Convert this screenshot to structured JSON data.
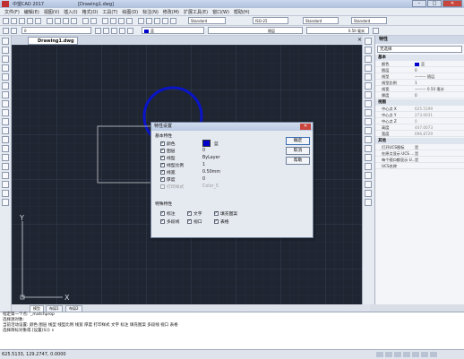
{
  "titlebar": {
    "app_title": "中望CAD 2017",
    "doc_title": "[Drawing1.dwg]",
    "min": "–",
    "max": "□",
    "close": "✕"
  },
  "menu": [
    "文件(F)",
    "编辑(E)",
    "视图(V)",
    "插入(I)",
    "格式(O)",
    "工具(T)",
    "绘图(D)",
    "标注(N)",
    "修改(M)",
    "扩展工具(E)",
    "窗口(W)",
    "帮助(H)"
  ],
  "toolbar": {
    "text_style": "Standard",
    "dim_style": "ISO-25",
    "table_style": "Standard",
    "mleader_style": "Standard",
    "layer": "0",
    "color": "蓝",
    "linetype": "随层",
    "lineweight": "0.50 毫米"
  },
  "tabs": {
    "document": "Drawing1.dwg",
    "close": "×"
  },
  "layout_tabs": [
    "模型",
    "布局1",
    "布局2"
  ],
  "command_lines": [
    "指定第一个点: '_matchprop",
    "选择源对象:",
    "当前活动设置: 颜色 图层 线型 线型比例 线宽 厚度 打印样式 文字 标注 填充图案 多段线 视口 表格",
    "选择目标对象或 [设置(S)]: s"
  ],
  "status": {
    "coords": "625.5133, 129.2747, 0.0000"
  },
  "properties_panel": {
    "title": "特性",
    "selection": "无选择",
    "section_basic": "基本",
    "section_view": "视图",
    "section_misc": "其他",
    "basic_rows": [
      {
        "k": "颜色",
        "v": "蓝",
        "swatch": true
      },
      {
        "k": "图层",
        "v": "0"
      },
      {
        "k": "线型",
        "v": "——— 随层"
      },
      {
        "k": "线型比例",
        "v": "1"
      },
      {
        "k": "线宽",
        "v": "——— 0.50 毫米"
      },
      {
        "k": "厚度",
        "v": "0"
      }
    ],
    "view_rows": [
      {
        "k": "中心点 X",
        "v": "625.5199"
      },
      {
        "k": "中心点 Y",
        "v": "273.0031"
      },
      {
        "k": "中心点 Z",
        "v": "0"
      },
      {
        "k": "高度",
        "v": "447.0073"
      },
      {
        "k": "宽度",
        "v": "696.8729"
      }
    ],
    "misc_rows": [
      {
        "k": "打开UCS图标",
        "v": "是"
      },
      {
        "k": "在原点显示 UCS ...",
        "v": "是"
      },
      {
        "k": "每个视口都显示 U...",
        "v": "是"
      },
      {
        "k": "UCS名称",
        "v": ""
      }
    ]
  },
  "dialog": {
    "title": "特性设置",
    "close": "✕",
    "group_basic": "基本特性",
    "rows": [
      {
        "label": "颜色",
        "value": "蓝",
        "checked": true,
        "disabled": false,
        "colorbox": true
      },
      {
        "label": "图层",
        "value": "0",
        "checked": true,
        "disabled": false
      },
      {
        "label": "线型",
        "value": "ByLayer",
        "checked": true,
        "disabled": false
      },
      {
        "label": "线型比例",
        "value": "1",
        "checked": true,
        "disabled": false
      },
      {
        "label": "线宽",
        "value": "0.50mm",
        "checked": true,
        "disabled": false
      },
      {
        "label": "厚度",
        "value": "0",
        "checked": true,
        "disabled": false
      },
      {
        "label": "打印样式",
        "value": "Color_5",
        "checked": false,
        "disabled": true
      }
    ],
    "group_special": "特殊特性",
    "special": [
      "标注",
      "文字",
      "填充图案",
      "多段线",
      "视口",
      "表格"
    ],
    "buttons": {
      "ok": "确定",
      "cancel": "取消",
      "help": "帮助"
    }
  },
  "canvas": {
    "ucs_x": "X",
    "ucs_y": "Y",
    "bg": "#1f2531",
    "circle_color": "#0a14c8"
  }
}
